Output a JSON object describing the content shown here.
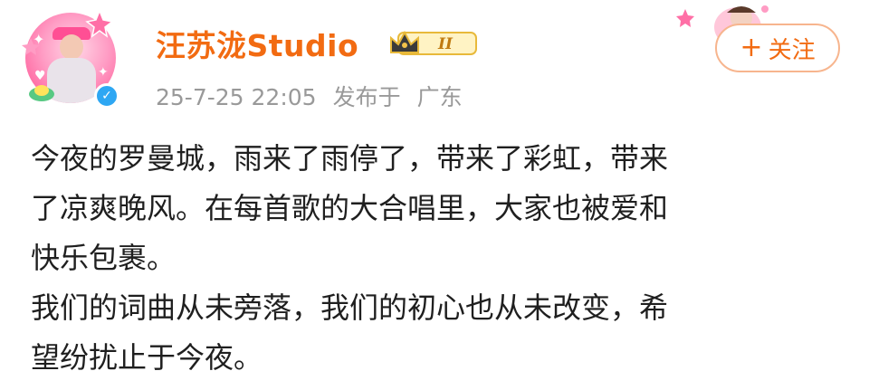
{
  "post": {
    "author": {
      "name": "汪苏泷Studio",
      "level_badge": "II",
      "verified": true
    },
    "meta": {
      "time": "25-7-25 22:05",
      "published_from": "发布于",
      "location": "广东"
    },
    "follow_button": {
      "plus": "+",
      "label": "关注"
    },
    "content_lines": [
      "今夜的罗曼城，雨来了雨停了，带来了彩虹，带来",
      "了凉爽晚风。在每首歌的大合唱里，大家也被爱和",
      "快乐包裹。",
      "我们的词曲从未旁落，我们的初心也从未改变，希",
      "望纷扰止于今夜。"
    ]
  },
  "colors": {
    "name": "#f26b12",
    "meta": "#999999",
    "text": "#1f1f1f",
    "verified": "#2ea7f3",
    "follow_border": "#f7b58e"
  },
  "icons": {
    "verified": "check-icon",
    "level": "crown-icon"
  }
}
